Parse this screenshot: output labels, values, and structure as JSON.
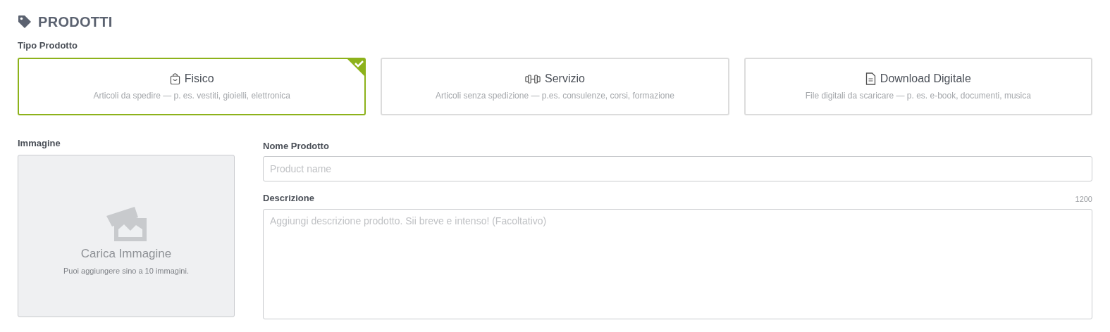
{
  "section": {
    "title": "PRODOTTI"
  },
  "product_type": {
    "label": "Tipo Prodotto",
    "options": [
      {
        "kind": "bag",
        "title": "Fisico",
        "subtitle": "Articoli da spedire — p. es. vestiti, gioielli, elettronica",
        "selected": true
      },
      {
        "kind": "dumbbell",
        "title": "Servizio",
        "subtitle": "Articoli senza spedizione — p.es. consulenze, corsi, formazione",
        "selected": false
      },
      {
        "kind": "document",
        "title": "Download Digitale",
        "subtitle": "File digitali da scaricare — p. es. e-book, documenti, musica",
        "selected": false
      }
    ]
  },
  "image": {
    "label": "Immagine",
    "title": "Carica Immagine",
    "hint": "Puoi aggiungere sino a 10 immagini."
  },
  "name": {
    "label": "Nome Prodotto",
    "placeholder": "Product name"
  },
  "description": {
    "label": "Descrizione",
    "counter": "1200",
    "placeholder": "Aggiungi descrizione prodotto. Sii breve e intenso! (Facoltativo)"
  }
}
